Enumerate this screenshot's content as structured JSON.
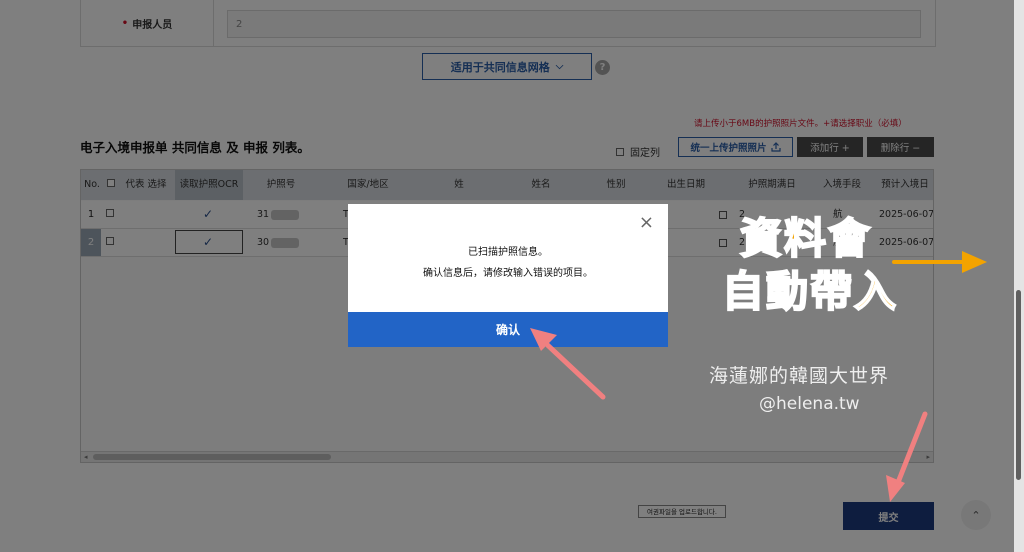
{
  "top_field": {
    "label": "申报人员",
    "required_mark": "•",
    "value": "2"
  },
  "apply_button": {
    "label": "适用于共同信息网格",
    "chevron": "⌵"
  },
  "help_icon": "?",
  "notice": "请上传小于6MB的护照照片文件。+请选择职业（必填）",
  "section_title": "电子入境申报单 共同信息 及 申报 列表。",
  "fixed_column_label": "固定列",
  "upload_button": {
    "label": "统一上传护照照片",
    "icon": "upload-icon"
  },
  "add_row_button": "添加行 +",
  "delete_row_button": "删除行 −",
  "table": {
    "headers": [
      "No.",
      "代表 选择",
      "读取护照OCR",
      "护照号",
      "国家/地区",
      "姓",
      "姓名",
      "性别",
      "出生日期",
      "护照期满日",
      "入境手段",
      "预计入境日"
    ],
    "rows": [
      {
        "no": "1",
        "ocr": "✓",
        "passport_partial": "31",
        "country_partial": "T",
        "expiry_partial": "2",
        "entry_partial": "航",
        "entry_date": "2025-06-07",
        "selected": false
      },
      {
        "no": "2",
        "ocr": "✓",
        "passport_partial": "30",
        "country_partial": "T",
        "expiry_partial": "2",
        "entry_partial": "航",
        "entry_date": "2025-06-07",
        "selected": true
      }
    ]
  },
  "modal": {
    "line1": "已扫描护照信息。",
    "line2": "确认信息后，请修改输入错误的项目。",
    "ok_label": "确认",
    "close": "×"
  },
  "tooltip": "여권파일을 업로드합니다.",
  "submit_button": "提交",
  "scroll_top": "⌃",
  "annotation": {
    "line1": "資料會",
    "line2": "自動帶入",
    "color": "#f3a300"
  },
  "watermark": {
    "name": "海蓮娜的韓國大世界",
    "handle": "@helena.tw"
  }
}
